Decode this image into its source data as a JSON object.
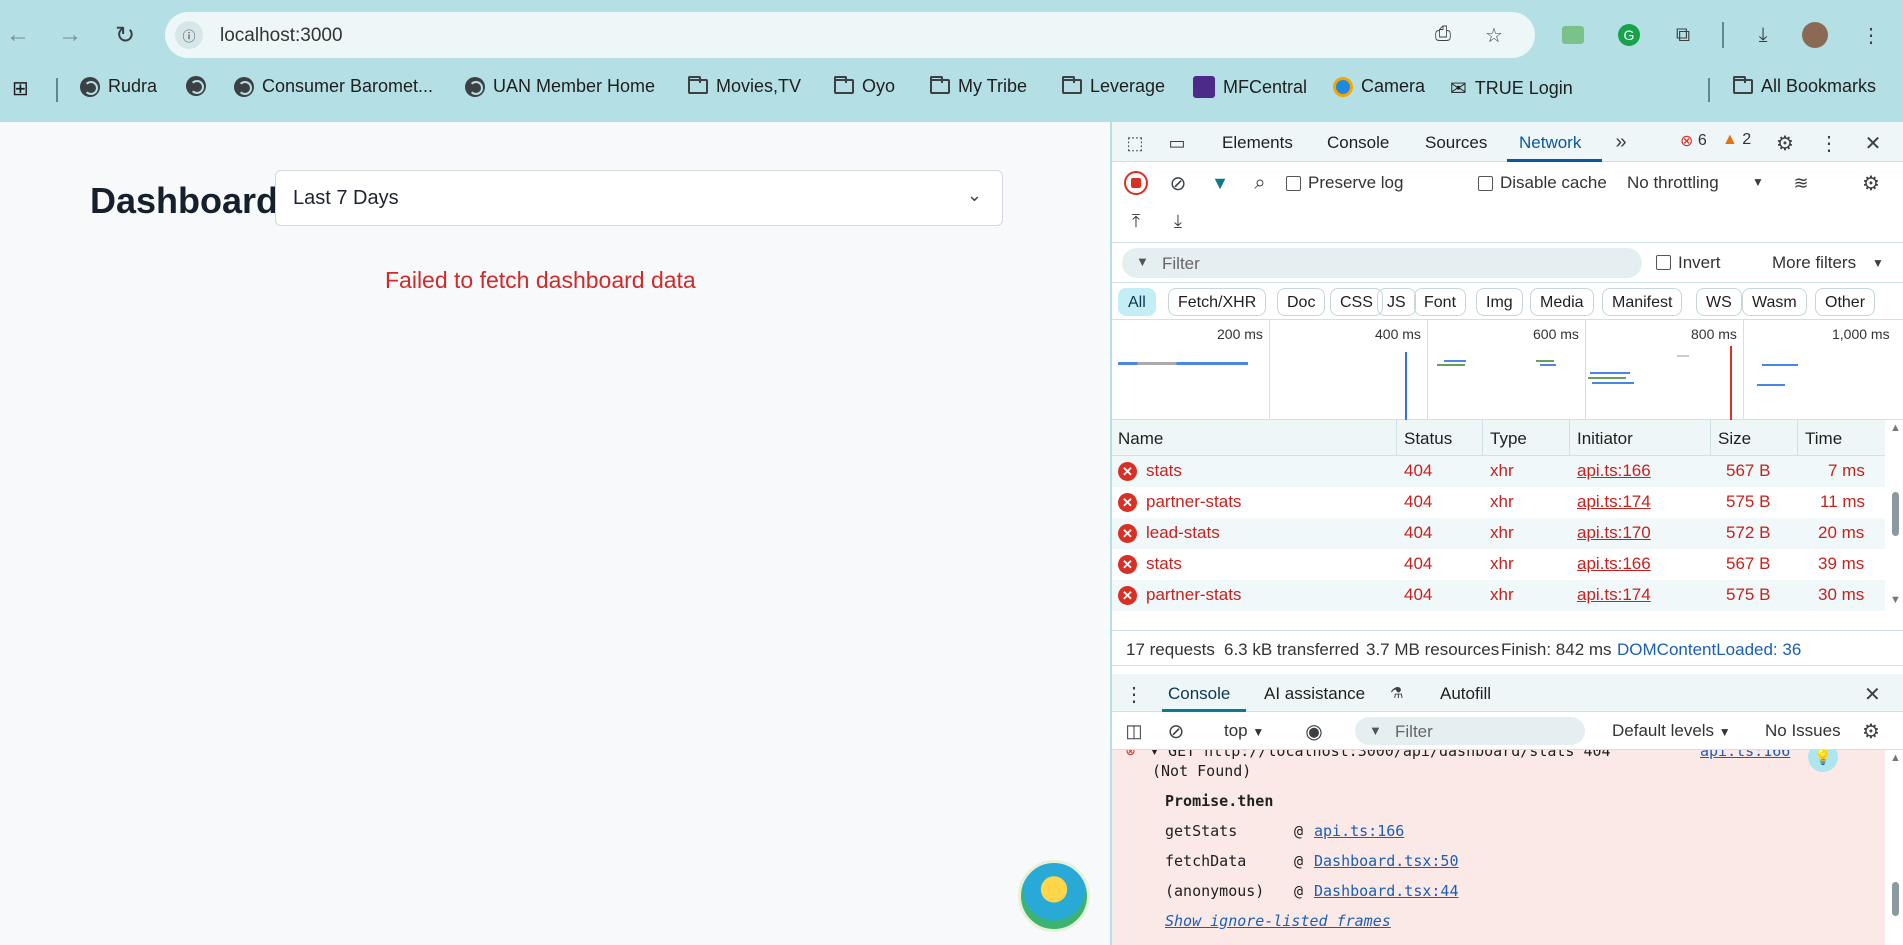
{
  "browser": {
    "url": "localhost:3000",
    "bookmarks": [
      {
        "label": "Rudra",
        "icon": "globe-icon"
      },
      {
        "label": "",
        "icon": "globe-icon"
      },
      {
        "label": "Consumer Baromet...",
        "icon": "globe-icon"
      },
      {
        "label": "UAN Member Home",
        "icon": "globe-icon"
      },
      {
        "label": "Movies,TV",
        "icon": "folder-icon"
      },
      {
        "label": "Oyo",
        "icon": "folder-icon"
      },
      {
        "label": "My Tribe",
        "icon": "folder-icon"
      },
      {
        "label": "Leverage",
        "icon": "folder-icon"
      },
      {
        "label": "MFCentral",
        "icon": "mfcentral-icon"
      },
      {
        "label": "Camera",
        "icon": "edge-icon"
      },
      {
        "label": "TRUE Login",
        "icon": "mail-icon"
      }
    ],
    "all_bookmarks": "All Bookmarks"
  },
  "page": {
    "title": "Dashboard",
    "range_select": "Last 7 Days",
    "error": "Failed to fetch dashboard data"
  },
  "devtools": {
    "tabs": [
      "Elements",
      "Console",
      "Sources",
      "Network"
    ],
    "active_tab": "Network",
    "errors": "6",
    "warnings": "2",
    "preserve_log": "Preserve log",
    "disable_cache": "Disable cache",
    "throttling": "No throttling",
    "filter_placeholder": "Filter",
    "invert": "Invert",
    "more_filters": "More filters",
    "chips": [
      "All",
      "Fetch/XHR",
      "Doc",
      "CSS",
      "JS",
      "Font",
      "Img",
      "Media",
      "Manifest",
      "WS",
      "Wasm",
      "Other"
    ],
    "timeline_labels": [
      "200 ms",
      "400 ms",
      "600 ms",
      "800 ms",
      "1,000 ms"
    ],
    "columns": [
      "Name",
      "Status",
      "Type",
      "Initiator",
      "Size",
      "Time"
    ],
    "rows": [
      {
        "name": "stats",
        "status": "404",
        "type": "xhr",
        "initiator": "api.ts:166",
        "size": "567 B",
        "time": "7 ms"
      },
      {
        "name": "partner-stats",
        "status": "404",
        "type": "xhr",
        "initiator": "api.ts:174",
        "size": "575 B",
        "time": "11 ms"
      },
      {
        "name": "lead-stats",
        "status": "404",
        "type": "xhr",
        "initiator": "api.ts:170",
        "size": "572 B",
        "time": "20 ms"
      },
      {
        "name": "stats",
        "status": "404",
        "type": "xhr",
        "initiator": "api.ts:166",
        "size": "567 B",
        "time": "39 ms"
      },
      {
        "name": "partner-stats",
        "status": "404",
        "type": "xhr",
        "initiator": "api.ts:174",
        "size": "575 B",
        "time": "30 ms"
      }
    ],
    "summary": {
      "requests": "17 requests",
      "transferred": "6.3 kB transferred",
      "resources": "3.7 MB resources",
      "finish": "Finish: 842 ms",
      "dcl": "DOMContentLoaded: 36"
    },
    "drawer_tabs": [
      "Console",
      "AI assistance",
      "Autofill"
    ],
    "console": {
      "context": "top",
      "filter_placeholder": "Filter",
      "levels": "Default levels",
      "issues": "No Issues",
      "get_line": "▾ GET http://localhost:3000/api/dashboard/stats 404",
      "get_src": "api.ts:166",
      "not_found": "(Not Found)",
      "promise": "Promise.then",
      "stack": [
        {
          "fn": "getStats",
          "at": "@",
          "src": "api.ts:166"
        },
        {
          "fn": "fetchData",
          "at": "@",
          "src": "Dashboard.tsx:50"
        },
        {
          "fn": "(anonymous)",
          "at": "@",
          "src": "Dashboard.tsx:44"
        }
      ],
      "show_frames": "Show ignore-listed frames"
    }
  }
}
